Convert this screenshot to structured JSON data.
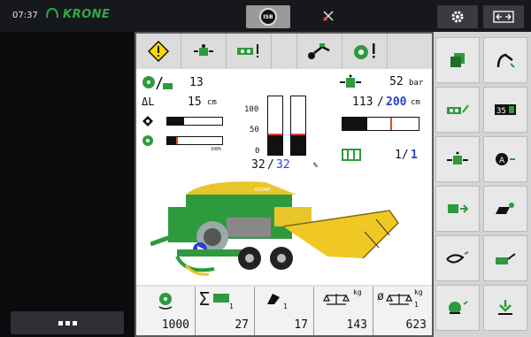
{
  "topbar": {
    "time": "07:37",
    "brand": "KRONE",
    "isb_label": "ISB"
  },
  "status": {
    "bales_icon_value": "13",
    "length_value": "15",
    "length_unit": "cm",
    "pressure_value": "52",
    "pressure_unit": "bar",
    "length_actual": "113",
    "length_target": "200",
    "length_target_unit": "cm",
    "knotter_count": "1/",
    "knotter_total": "1",
    "fill_actual": "32",
    "fill_target": "32",
    "fill_unit": "%",
    "gauge_ticks": [
      "100",
      "50",
      "0"
    ],
    "bar_small_label": "100%"
  },
  "counters": [
    {
      "name": "total-bales",
      "value": "1000"
    },
    {
      "name": "sum-bales",
      "sub": "1",
      "value": "27"
    },
    {
      "name": "cut-bales",
      "sub": "1",
      "value": "17"
    },
    {
      "name": "weight",
      "unit": "kg",
      "value": "143"
    },
    {
      "name": "avg-weight",
      "unit": "kg",
      "sub": "1",
      "value": "623"
    }
  ],
  "colors": {
    "accent_green": "#2e9a3e",
    "krone_yellow": "#e8c52a",
    "target_blue": "#2a3fd0"
  },
  "right_icons": [
    "bale-stack-icon",
    "knife-icon",
    "baler-settings-icon",
    "counter-icon",
    "pressure-icon",
    "knotter-icon",
    "bale-eject-icon",
    "lubrication-icon",
    "pickup-icon",
    "chute-icon",
    "sensor-icon",
    "rotor-icon"
  ]
}
